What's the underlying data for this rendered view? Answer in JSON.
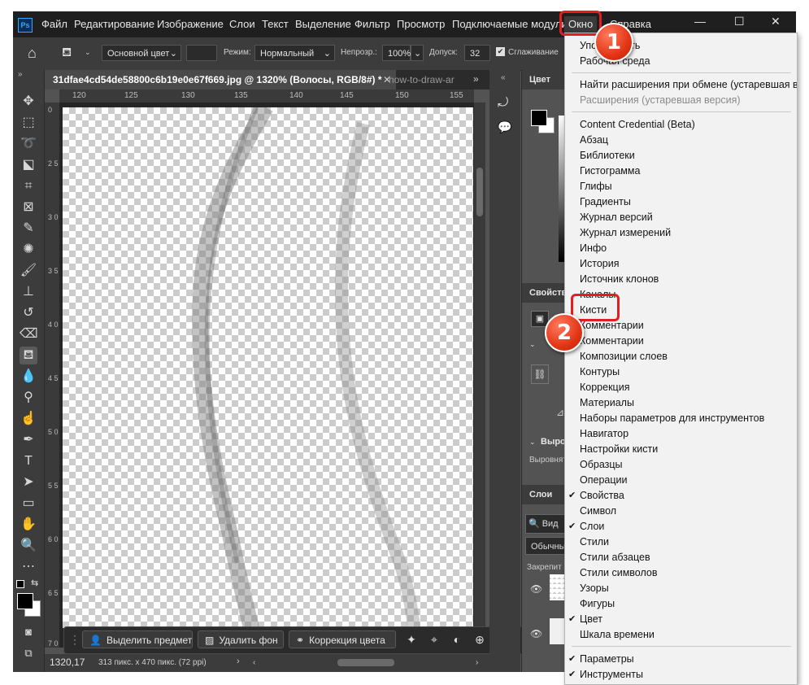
{
  "menubar": {
    "logo": "Ps",
    "items": [
      "Файл",
      "Редактирование",
      "Изображение",
      "Слои",
      "Текст",
      "Выделение",
      "Фильтр",
      "Просмотр",
      "Подключаемые модули",
      "Окно",
      "Справка"
    ]
  },
  "options": {
    "fill_source": "Основной цвет",
    "mode_label": "Режим:",
    "mode_value": "Нормальный",
    "opacity_label": "Непрозр.:",
    "opacity_value": "100%",
    "tolerance_label": "Допуск:",
    "tolerance_value": "32",
    "antialias_label": "Сглаживание"
  },
  "doc_tabs": {
    "active": "31dfae4cd54de58800c6b19e0e67f669.jpg @ 1320% (Волосы, RGB/8#) *",
    "inactive": "how-to-draw-ar"
  },
  "ruler_top": [
    "120",
    "125",
    "130",
    "135",
    "140",
    "145",
    "150",
    "155"
  ],
  "ruler_left": [
    "0",
    "2 5",
    "3 0",
    "3 5",
    "4 0",
    "4 5",
    "5 0",
    "5 5",
    "6 0",
    "6 5",
    "7 0"
  ],
  "context_bar": {
    "select_subject": "Выделить предмет",
    "remove_bg": "Удалить фон",
    "color_correction": "Коррекция цвета"
  },
  "status": {
    "zoom": "1320,17",
    "doc_info": "313 пикс. x 470 пикс. (72 ppi)"
  },
  "panels": {
    "color": "Цвет",
    "properties": "Свойства",
    "properties_sub": "Пи",
    "align": "Выро",
    "align_sub": "Выровнят",
    "layers": "Слои",
    "layers_search": "Вид",
    "layers_blend": "Обычны",
    "layers_lock": "Закрепит"
  },
  "window_menu": {
    "group1": [
      "Упорядочить",
      "Рабочая среда"
    ],
    "group2": [
      "Найти расширения при обмене (устаревшая версия)",
      "Расширения (устаревшая версия)"
    ],
    "group3": [
      "Content Credential (Beta)",
      "Абзац",
      "Библиотеки",
      "Гистограмма",
      "Глифы",
      "Градиенты",
      "Журнал версий",
      "Журнал измерений",
      "Инфо",
      "История",
      "Источник клонов",
      "Каналы",
      "Кисти",
      "Комментарии",
      "Комментарии",
      "Композиции слоев",
      "Контуры",
      "Коррекция",
      "Материалы",
      "Наборы параметров для инструментов",
      "Навигатор",
      "Настройки кисти",
      "Образцы",
      "Операции",
      "Свойства",
      "Символ",
      "Слои",
      "Стили",
      "Стили абзацев",
      "Стили символов",
      "Узоры",
      "Фигуры",
      "Цвет",
      "Шкала времени"
    ],
    "group4": [
      "Параметры",
      "Инструменты"
    ],
    "check_mark": "✔"
  },
  "badges": [
    "1",
    "2"
  ],
  "colors": {
    "highlight": "#e41e1e",
    "app_bg": "#535353",
    "menu_bg": "#f2f2f2"
  }
}
